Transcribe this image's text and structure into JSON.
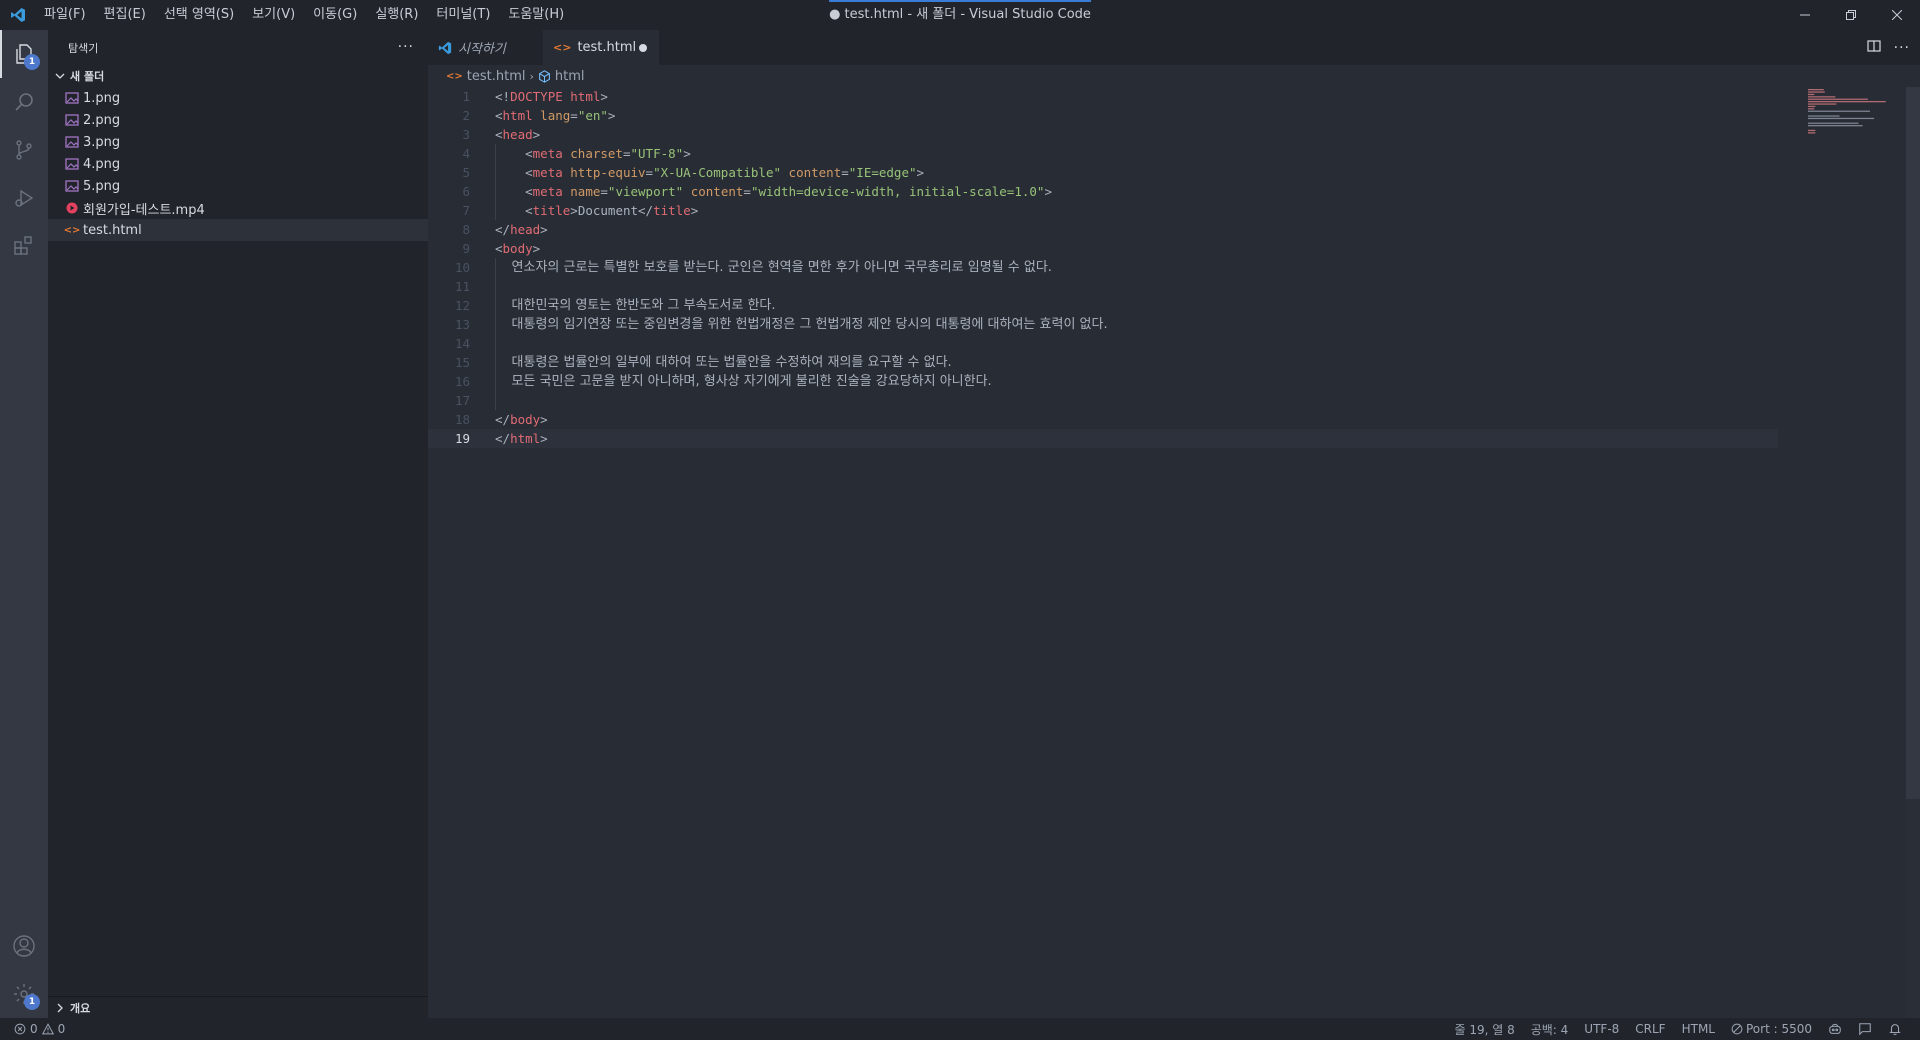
{
  "window": {
    "title": "● test.html - 새 폴더 - Visual Studio Code",
    "menu": [
      "파일(F)",
      "편집(E)",
      "선택 영역(S)",
      "보기(V)",
      "이동(G)",
      "실행(R)",
      "터미널(T)",
      "도움말(H)"
    ]
  },
  "activitybar": {
    "explorer_badge": "1",
    "settings_badge": "1",
    "icons": [
      "explorer-icon",
      "search-icon",
      "source-control-icon",
      "run-debug-icon",
      "extensions-icon",
      "account-icon",
      "settings-gear-icon"
    ]
  },
  "sidebar": {
    "title": "탐색기",
    "more": "···",
    "folder_name": "새 폴더",
    "files": [
      {
        "name": "1.png",
        "type": "image"
      },
      {
        "name": "2.png",
        "type": "image"
      },
      {
        "name": "3.png",
        "type": "image"
      },
      {
        "name": "4.png",
        "type": "image"
      },
      {
        "name": "5.png",
        "type": "image"
      },
      {
        "name": "회원가입-테스트.mp4",
        "type": "video"
      },
      {
        "name": "test.html",
        "type": "html",
        "selected": true
      }
    ],
    "outline_label": "개요"
  },
  "tabs": [
    {
      "label": "시작하기",
      "active": false
    },
    {
      "label": "test.html",
      "active": true,
      "dirty": true
    }
  ],
  "breadcrumb": {
    "file": "test.html",
    "symbol": "html"
  },
  "code_lines": [
    "<!DOCTYPE html>",
    "<html lang=\"en\">",
    "<head>",
    "    <meta charset=\"UTF-8\">",
    "    <meta http-equiv=\"X-UA-Compatible\" content=\"IE=edge\">",
    "    <meta name=\"viewport\" content=\"width=device-width, initial-scale=1.0\">",
    "    <title>Document</title>",
    "</head>",
    "<body>",
    "    연소자의 근로는 특별한 보호를 받는다. 군인은 현역을 면한 후가 아니면 국무총리로 임명될 수 없다.",
    "",
    "    대한민국의 영토는 한반도와 그 부속도서로 한다.",
    "    대통령의 임기연장 또는 중임변경을 위한 헌법개정은 그 헌법개정 제안 당시의 대통령에 대하여는 효력이 없다.",
    "",
    "    대통령은 법률안의 일부에 대하여 또는 법률안을 수정하여 재의를 요구할 수 없다.",
    "    모든 국민은 고문을 받지 아니하며, 형사상 자기에게 불리한 진술을 강요당하지 아니한다.",
    "",
    "</body>",
    "</html>"
  ],
  "current_line": 19,
  "statusbar": {
    "errors": "0",
    "warnings": "0",
    "position": "줄 19, 열 8",
    "spaces": "공백: 4",
    "encoding": "UTF-8",
    "eol": "CRLF",
    "language": "HTML",
    "port": "Port : 5500"
  },
  "colors": {
    "accent": "#3a7bd5",
    "tag": "#e06c75",
    "attribute": "#d19a66",
    "string": "#98c379",
    "badge": "#4d78cc"
  }
}
